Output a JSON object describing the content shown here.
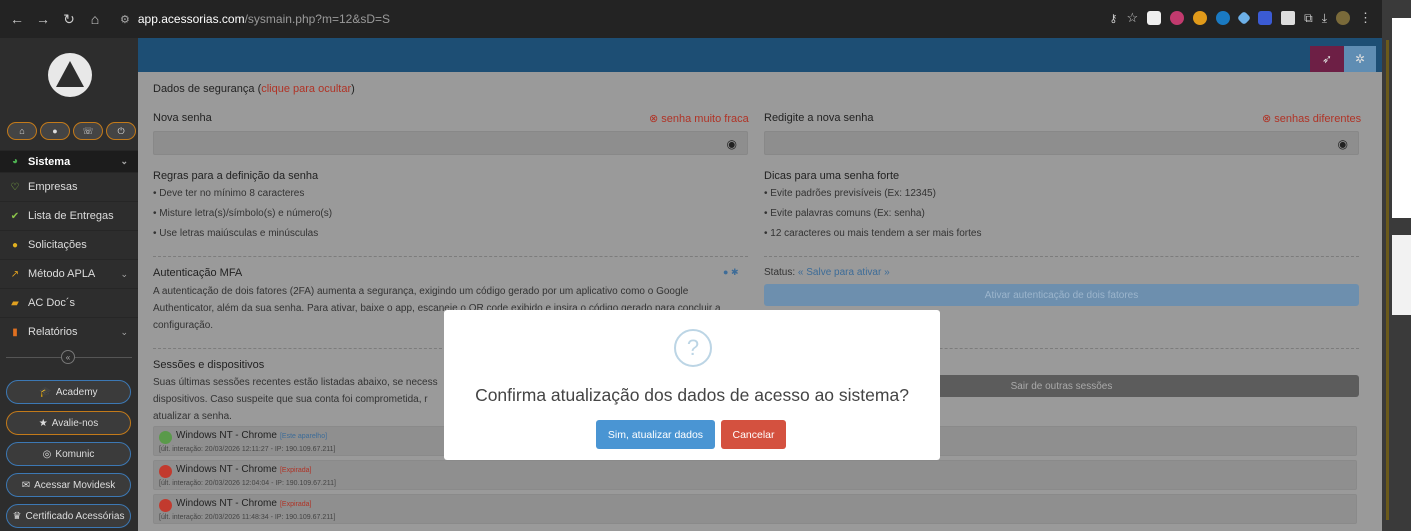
{
  "browser": {
    "url_host": "app.acessorias.com",
    "url_path": "/sysmain.php?m=12&sD=S",
    "nav_icons": [
      "back-icon",
      "forward-icon",
      "reload-icon",
      "home-icon",
      "site-settings-icon"
    ]
  },
  "sidebar": {
    "menu": [
      {
        "label": "Sistema",
        "icon": "globe-icon",
        "active": true,
        "chevron": true
      },
      {
        "label": "Empresas",
        "icon": "heart-icon",
        "active": false,
        "chevron": false
      },
      {
        "label": "Lista de Entregas",
        "icon": "check-circle-icon",
        "active": false,
        "chevron": false
      },
      {
        "label": "Solicitações",
        "icon": "chat-icon",
        "active": false,
        "chevron": false
      },
      {
        "label": "Método APLA",
        "icon": "chart-icon",
        "active": false,
        "chevron": true
      },
      {
        "label": "AC Doc´s",
        "icon": "folder-icon",
        "active": false,
        "chevron": false
      },
      {
        "label": "Relatórios",
        "icon": "book-icon",
        "active": false,
        "chevron": true
      }
    ],
    "buttons": {
      "academy": "Academy",
      "rate": "Avalie-nos",
      "comunic": "Komunic",
      "movidesk": "Acessar Movidesk",
      "certificate": "Certificado Acessórias"
    }
  },
  "security": {
    "header": "Dados de segurança (",
    "header_link": "clique para ocultar",
    "header_end": ")",
    "new_password_label": "Nova senha",
    "new_password_status": "senha muito fraca",
    "confirm_password_label": "Redigite a nova senha",
    "confirm_password_status": "senhas diferentes",
    "rules_title": "Regras para a definição da senha",
    "rules": [
      "• Deve ter no mínimo 8 caracteres",
      "• Misture letra(s)/símbolo(s) e número(s)",
      "• Use letras maiúsculas e minúsculas"
    ],
    "tips_title": "Dicas para uma senha forte",
    "tips": [
      "• Evite padrões previsíveis (Ex: 12345)",
      "• Evite palavras comuns (Ex: senha)",
      "• 12 caracteres ou mais tendem a ser mais fortes"
    ]
  },
  "mfa": {
    "title": "Autenticação MFA",
    "desc_lines": [
      "A autenticação de dois fatores (2FA) aumenta a segurança, exigindo um código gerado por um aplicativo como o Google",
      "Authenticator, além da sua senha. Para ativar, baixe o app, escaneie o QR code exibido e insira o código gerado para concluir a",
      "configuração."
    ],
    "status_label": "Status:",
    "status_value": "« Salve para ativar »",
    "activate_button": "Ativar autenticação de dois fatores"
  },
  "sessions": {
    "title": "Sessões e dispositivos",
    "desc_lines": [
      "Suas últimas sessões recentes estão listadas abaixo, se necess",
      "dispositivos. Caso suspeite que sua conta foi comprometida, r",
      "atualizar a senha."
    ],
    "logout_others_button": "Sair de outras sessões",
    "items": [
      {
        "name": "Windows NT - Chrome",
        "tag": "[Este aparelho]",
        "info": "[últ. interação: 20/03/2026 12:11:27 - IP: 190.109.67.211]",
        "color": "#5a9a4a"
      },
      {
        "name": "Windows NT - Chrome",
        "tag": "[Expirada]",
        "info": "[últ. interação: 20/03/2026 12:04:04 - IP: 190.109.67.211]",
        "color": "#c23a2e"
      },
      {
        "name": "Windows NT - Chrome",
        "tag": "[Expirada]",
        "info": "[últ. interação: 20/03/2026 11:48:34 - IP: 190.109.67.211]",
        "color": "#c23a2e"
      }
    ]
  },
  "modal": {
    "icon": "?",
    "title": "Confirma atualização dos dados de acesso ao sistema?",
    "confirm": "Sim, atualizar dados",
    "cancel": "Cancelar"
  },
  "colors": {
    "topbar": "#1d4e74",
    "confirm": "#4a95d3",
    "cancel": "#d4513f",
    "sidebar": "#2d2d2d",
    "accent_orange": "#c37a1a"
  }
}
